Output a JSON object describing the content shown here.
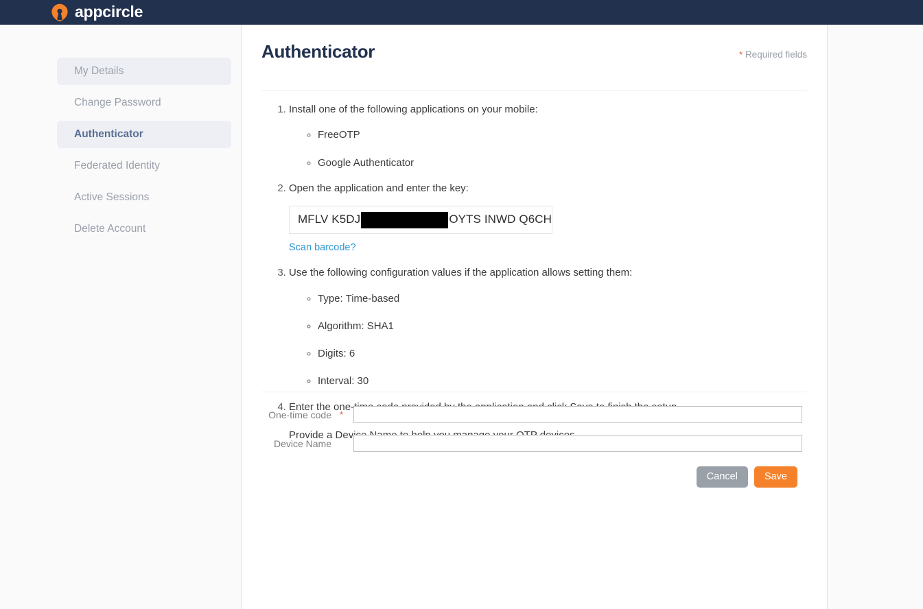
{
  "topbar": {
    "brand_name": "appcircle",
    "logo_icon": "appcircle-balloon-icon",
    "bg_color": "#22314e",
    "accent_color": "#f5822a"
  },
  "sidebar": {
    "items": [
      {
        "label": "My Details",
        "state": "shaded"
      },
      {
        "label": "Change Password",
        "state": "default"
      },
      {
        "label": "Authenticator",
        "state": "active"
      },
      {
        "label": "Federated Identity",
        "state": "default"
      },
      {
        "label": "Active Sessions",
        "state": "default"
      },
      {
        "label": "Delete Account",
        "state": "default"
      }
    ]
  },
  "header": {
    "title": "Authenticator",
    "required_star": "*",
    "required_note": "Required fields"
  },
  "instructions": {
    "step1": {
      "text": "Install one of the following applications on your mobile:",
      "apps": [
        "FreeOTP",
        "Google Authenticator"
      ]
    },
    "step2": {
      "text": "Open the application and enter the key:",
      "key_prefix": "MFLV K5DJ ",
      "key_redacted": "redacted",
      "key_suffix": "OYTS INWD Q6CH",
      "barcode_link": "Scan barcode?"
    },
    "step3": {
      "text": "Use the following configuration values if the application allows setting them:",
      "values": [
        "Type: Time-based",
        "Algorithm: SHA1",
        "Digits: 6",
        "Interval: 30"
      ]
    },
    "step4": {
      "text": "Enter the one-time code provided by the application and click Save to finish the setup.",
      "note": "Provide a Device Name to help you manage your OTP devices."
    }
  },
  "form": {
    "otp": {
      "label": "One-time code",
      "required_star": "*",
      "value": "",
      "placeholder": ""
    },
    "device": {
      "label": "Device Name",
      "value": "",
      "placeholder": ""
    },
    "cancel_label": "Cancel",
    "save_label": "Save",
    "cancel_color": "#9aa0a8",
    "save_color": "#f5822a"
  }
}
